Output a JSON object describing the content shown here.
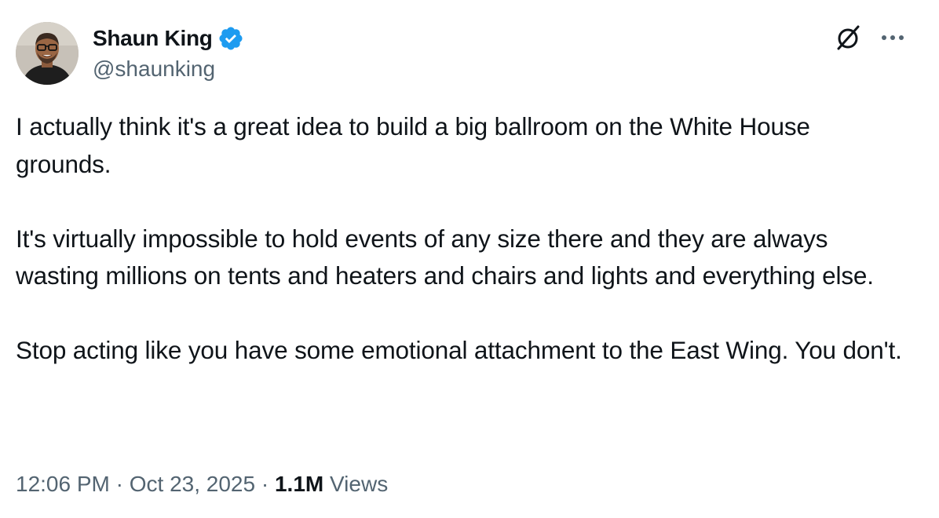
{
  "author": {
    "display_name": "Shaun King",
    "handle": "@shaunking",
    "verified": true
  },
  "tweet": {
    "paragraphs": [
      "I actually think it's a great idea to build a big ballroom on the White House grounds.",
      "It's virtually impossible to hold events of any size there and they are always wasting millions on tents and heaters and chairs and lights and everything else.",
      "Stop acting like you have some emotional attachment to the East Wing. You don't."
    ]
  },
  "meta": {
    "time": "12:06 PM",
    "separator": "·",
    "date": "Oct 23, 2025",
    "views_count": "1.1M",
    "views_label": "Views"
  },
  "icons": {
    "verified": "verified-badge-icon",
    "grok": "grok-icon",
    "more": "more-dots-icon"
  },
  "colors": {
    "text": "#0f1419",
    "secondary": "#536471",
    "verified": "#1d9bf0",
    "background": "#ffffff"
  }
}
